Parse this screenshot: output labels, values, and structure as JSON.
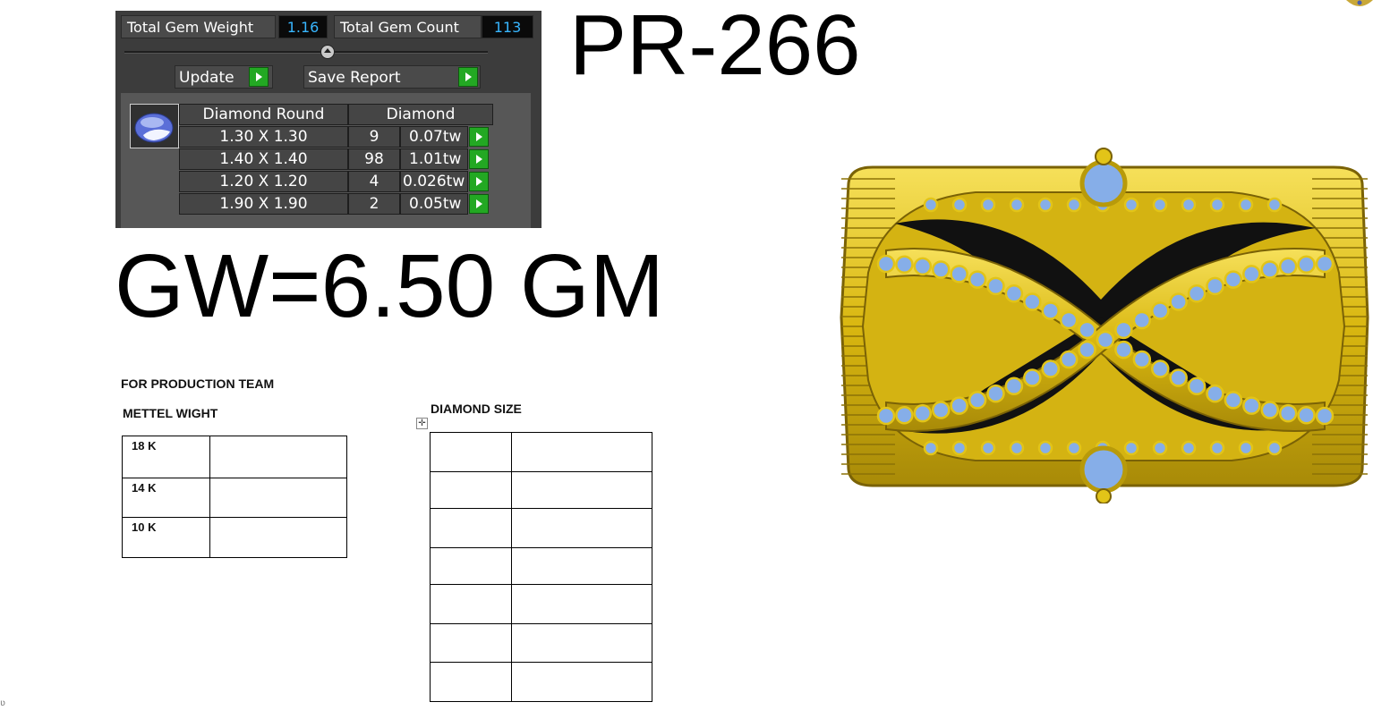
{
  "gem_panel": {
    "total_gem_weight_label": "Total Gem Weight",
    "total_gem_weight_value": "1.16",
    "total_gem_count_label": "Total Gem Count",
    "total_gem_count_value": "113",
    "update_label": "Update",
    "save_report_label": "Save Report",
    "gem_shape_header": "Diamond Round",
    "gem_type_header": "Diamond",
    "rows": [
      {
        "size": "1.30 X 1.30",
        "count": "9",
        "weight": "0.07tw"
      },
      {
        "size": "1.40 X 1.40",
        "count": "98",
        "weight": "1.01tw"
      },
      {
        "size": "1.20 X 1.20",
        "count": "4",
        "weight": "0.026tw"
      },
      {
        "size": "1.90 X 1.90",
        "count": "2",
        "weight": "0.05tw"
      }
    ],
    "icons": {
      "gem": "round-diamond-icon",
      "go": "play-arrow-icon",
      "slider": "slider-knob-icon"
    }
  },
  "part_number": "PR-266",
  "gross_weight": "GW=6.50 GM",
  "production": {
    "team_heading": "FOR PRODUCTION TEAM",
    "metal_heading": "METTEL WIGHT",
    "metals": [
      "18 K",
      "14 K",
      "10 K"
    ],
    "diamond_heading": "DIAMOND SIZE"
  },
  "colors": {
    "gold": "#e2c418",
    "stone": "#86aee8",
    "panel": "#3c3c3c",
    "accent_value": "#38b6ff",
    "go_green": "#23a823"
  }
}
